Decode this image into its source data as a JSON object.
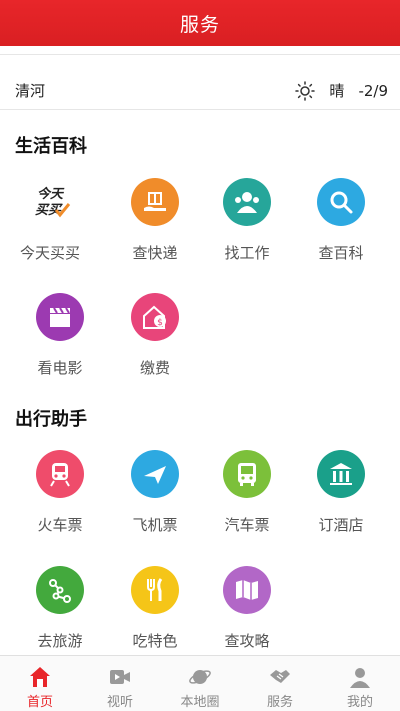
{
  "header": {
    "title": "服务"
  },
  "weather": {
    "city": "清河",
    "condition": "晴",
    "temperature": "-2/9",
    "icon": "sun-icon"
  },
  "life": {
    "title": "生活百科",
    "items": [
      {
        "label": "今天买买",
        "icon": "jintian-maimai-logo",
        "color": "#ffffff"
      },
      {
        "label": "查快递",
        "icon": "package-icon",
        "color": "#f08c2a"
      },
      {
        "label": "找工作",
        "icon": "people-icon",
        "color": "#26a69a"
      },
      {
        "label": "查百科",
        "icon": "search-icon",
        "color": "#2da9e1"
      },
      {
        "label": "看电影",
        "icon": "clapperboard-icon",
        "color": "#9c3ab1"
      },
      {
        "label": "缴费",
        "icon": "house-coin-icon",
        "color": "#e8457a"
      }
    ]
  },
  "travel": {
    "title": "出行助手",
    "items": [
      {
        "label": "火车票",
        "icon": "train-icon",
        "color": "#ef4c6b"
      },
      {
        "label": "飞机票",
        "icon": "airplane-icon",
        "color": "#2da9e1"
      },
      {
        "label": "汽车票",
        "icon": "bus-icon",
        "color": "#7cc03a"
      },
      {
        "label": "订酒店",
        "icon": "hotel-icon",
        "color": "#1aa08a"
      },
      {
        "label": "去旅游",
        "icon": "route-icon",
        "color": "#43a93d"
      },
      {
        "label": "吃特色",
        "icon": "fork-knife-icon",
        "color": "#f5c518"
      },
      {
        "label": "查攻略",
        "icon": "map-icon",
        "color": "#b267c7"
      }
    ]
  },
  "tabbar": {
    "tabs": [
      {
        "label": "首页",
        "icon": "home-icon",
        "active": true
      },
      {
        "label": "视听",
        "icon": "video-icon",
        "active": false
      },
      {
        "label": "本地圈",
        "icon": "planet-icon",
        "active": false
      },
      {
        "label": "服务",
        "icon": "handshake-icon",
        "active": false
      },
      {
        "label": "我的",
        "icon": "user-icon",
        "active": false
      }
    ]
  },
  "colors": {
    "accent": "#e8262a"
  }
}
